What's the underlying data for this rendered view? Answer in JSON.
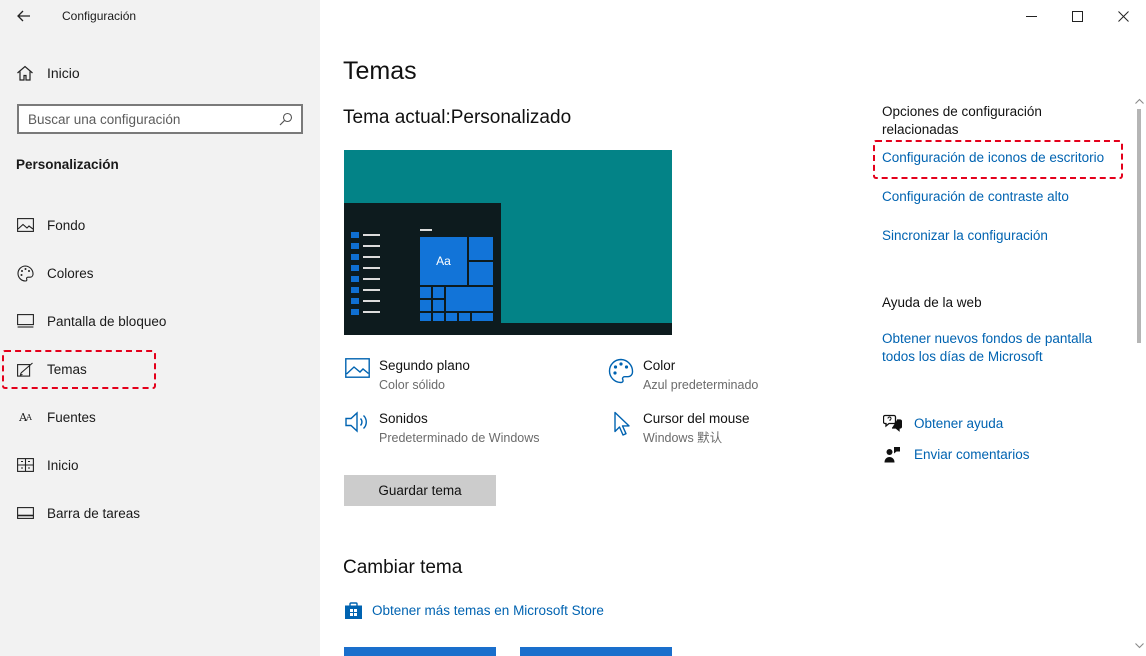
{
  "window": {
    "app_title": "Configuración",
    "controls": {
      "minimize": "minimize-icon",
      "maximize": "maximize-icon",
      "close": "close-icon"
    }
  },
  "sidebar": {
    "home_label": "Inicio",
    "search_placeholder": "Buscar una configuración",
    "section_heading": "Personalización",
    "items": [
      {
        "label": "Fondo",
        "icon": "picture-icon"
      },
      {
        "label": "Colores",
        "icon": "palette-icon"
      },
      {
        "label": "Pantalla de bloqueo",
        "icon": "lock-screen-icon"
      },
      {
        "label": "Temas",
        "icon": "themes-icon",
        "selected": true
      },
      {
        "label": "Fuentes",
        "icon": "fonts-icon"
      },
      {
        "label": "Inicio",
        "icon": "start-icon"
      },
      {
        "label": "Barra de tareas",
        "icon": "taskbar-icon"
      }
    ]
  },
  "main": {
    "title": "Temas",
    "current_theme": "Tema actual:Personalizado",
    "preview": {
      "tile_label": "Aa",
      "accent_color": "#038387",
      "tile_color": "#1274d8"
    },
    "properties": [
      {
        "title": "Segundo plano",
        "value": "Color sólido",
        "icon": "picture-icon"
      },
      {
        "title": "Color",
        "value": "Azul predeterminado",
        "icon": "palette-icon"
      },
      {
        "title": "Sonidos",
        "value": "Predeterminado de Windows",
        "icon": "speaker-icon"
      },
      {
        "title": "Cursor del mouse",
        "value": "Windows 默认",
        "icon": "cursor-icon"
      }
    ],
    "save_button": "Guardar tema",
    "change_theme_title": "Cambiar tema",
    "store_link": "Obtener más temas en Microsoft Store"
  },
  "related": {
    "heading": "Opciones de configuración relacionadas",
    "links": [
      "Configuración de iconos de escritorio",
      "Configuración de contraste alto",
      "Sincronizar la configuración"
    ],
    "web_heading": "Ayuda de la web",
    "web_link": "Obtener nuevos fondos de pantalla todos los días de Microsoft",
    "help_link": "Obtener ayuda",
    "feedback_link": "Enviar comentarios"
  },
  "colors": {
    "link": "#0063b1",
    "highlight": "#e4001b",
    "sidebar_bg": "#f2f2f2"
  }
}
